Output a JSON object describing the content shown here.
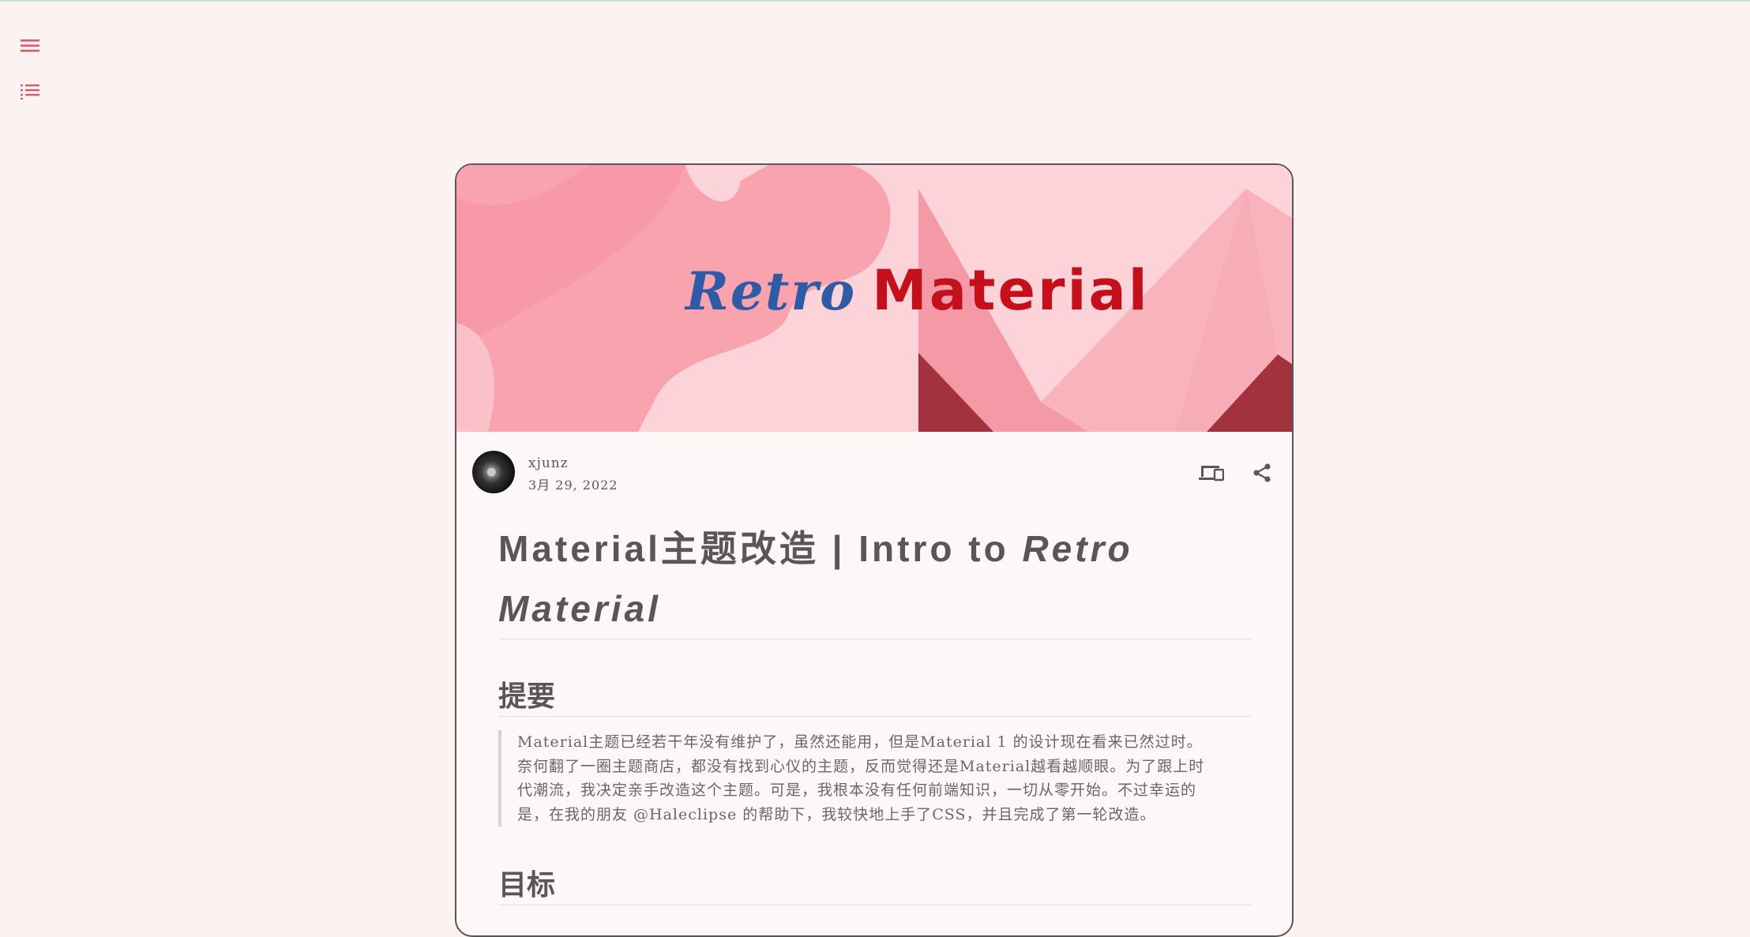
{
  "nav": {
    "menu_icon": "menu-icon",
    "toc_icon": "toc-icon"
  },
  "banner": {
    "word1": "Retro",
    "word2": "Material",
    "colors": {
      "word1": "#2f5aa5",
      "word2": "#c3101a",
      "background": "#fbc9cf"
    }
  },
  "post": {
    "author": "xjunz",
    "date": "3月 29, 2022",
    "title_plain": "Material主题改造 | Intro to ",
    "title_italic": "Retro Material",
    "device_icon": "devices-icon",
    "share_icon": "share-icon"
  },
  "sections": [
    {
      "heading": "提要",
      "quote_lines": [
        "Material主题已经若干年没有维护了，虽然还能用，但是Material 1 的设计现在看来已然过时。",
        "奈何翻了一圈主题商店，都没有找到心仪的主题，反而觉得还是Material越看越顺眼。为了跟上时",
        "代潮流，我决定亲手改造这个主题。可是，我根本没有任何前端知识，一切从零开始。不过幸运的",
        "是，在我的朋友 @Haleclipse 的帮助下，我较快地上手了CSS，并且完成了第一轮改造。"
      ]
    },
    {
      "heading": "目标"
    }
  ]
}
